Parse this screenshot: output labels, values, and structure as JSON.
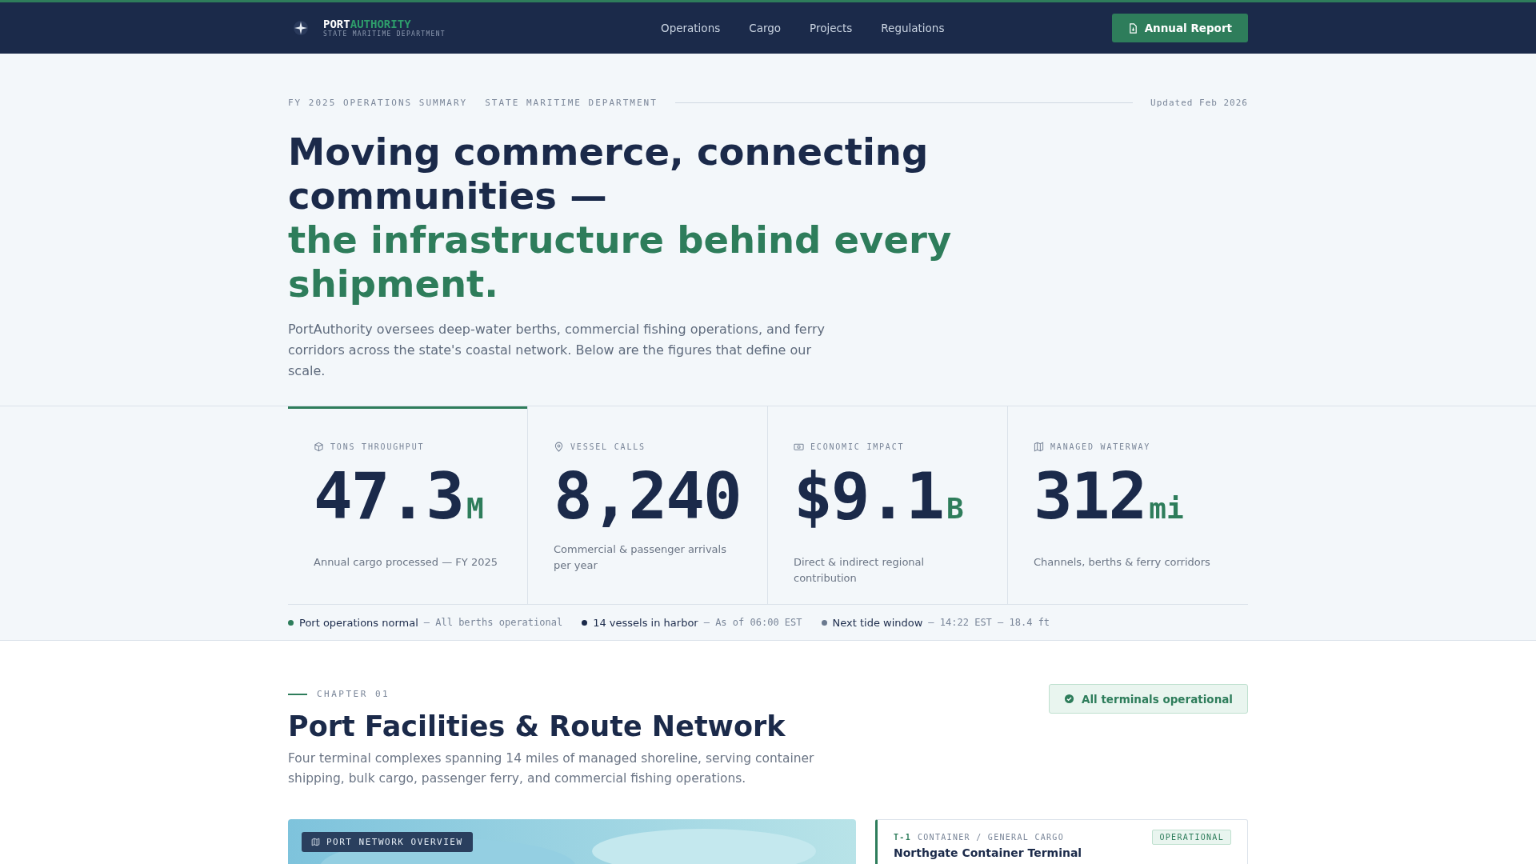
{
  "header": {
    "logo_primary": "PORT",
    "logo_accent": "AUTHORITY",
    "logo_sub": "STATE MARITIME DEPARTMENT",
    "nav": [
      "Operations",
      "Cargo",
      "Projects",
      "Regulations"
    ],
    "cta": "Annual Report"
  },
  "hero": {
    "eyebrow": [
      "FY 2025 OPERATIONS SUMMARY",
      "STATE MARITIME DEPARTMENT"
    ],
    "updated": "Updated Feb 2026",
    "title_lines": [
      "Moving commerce, connecting communities —"
    ],
    "title_accent": "the infrastructure behind every shipment.",
    "lead": "PortAuthority oversees deep-water berths, commercial fishing operations, and ferry corridors across the state's coastal network. Below are the figures that define our scale."
  },
  "stats": [
    {
      "kind": "cube",
      "label": "TONS THROUGHPUT",
      "value": "47.3",
      "unit": "M",
      "caption": "Annual cargo processed — FY 2025",
      "selected": true
    },
    {
      "kind": "pin",
      "label": "VESSEL CALLS",
      "value": "8,240",
      "caption": "Commercial & passenger arrivals per year",
      "selected": false
    },
    {
      "kind": "money",
      "label": "ECONOMIC IMPACT",
      "value": "$9.1",
      "unit": "B",
      "caption": "Direct & indirect regional contribution",
      "selected": false
    },
    {
      "kind": "map",
      "label": "MANAGED WATERWAY",
      "value": "312",
      "unit": "mi",
      "caption": "Channels, berths & ferry corridors",
      "selected": false
    }
  ],
  "status": [
    {
      "label": "Port operations normal",
      "detail": "— All berths operational",
      "color": "#2e7d5b"
    },
    {
      "label": "14 vessels in harbor",
      "detail": "— As of 06:00 EST",
      "color": "#1b2a4a"
    },
    {
      "label": "Next tide window",
      "detail": "— 14:22 EST — 18.4 ft",
      "color": "#6b7a8f"
    }
  ],
  "chapter": {
    "eyebrow": "CHAPTER 01",
    "title": "Port Facilities & Route Network",
    "lead": "Four terminal complexes spanning 14 miles of managed shoreline, serving container shipping, bulk cargo, passenger ferry, and commercial fishing operations.",
    "badge": "All terminals operational"
  },
  "map_panel": {
    "kind": "picture",
    "tag": "PORT NETWORK OVERVIEW"
  },
  "terminal": {
    "code": "T-1",
    "type": "CONTAINER / GENERAL CARGO",
    "status": "OPERATIONAL",
    "name": "Northgate Container Terminal"
  }
}
